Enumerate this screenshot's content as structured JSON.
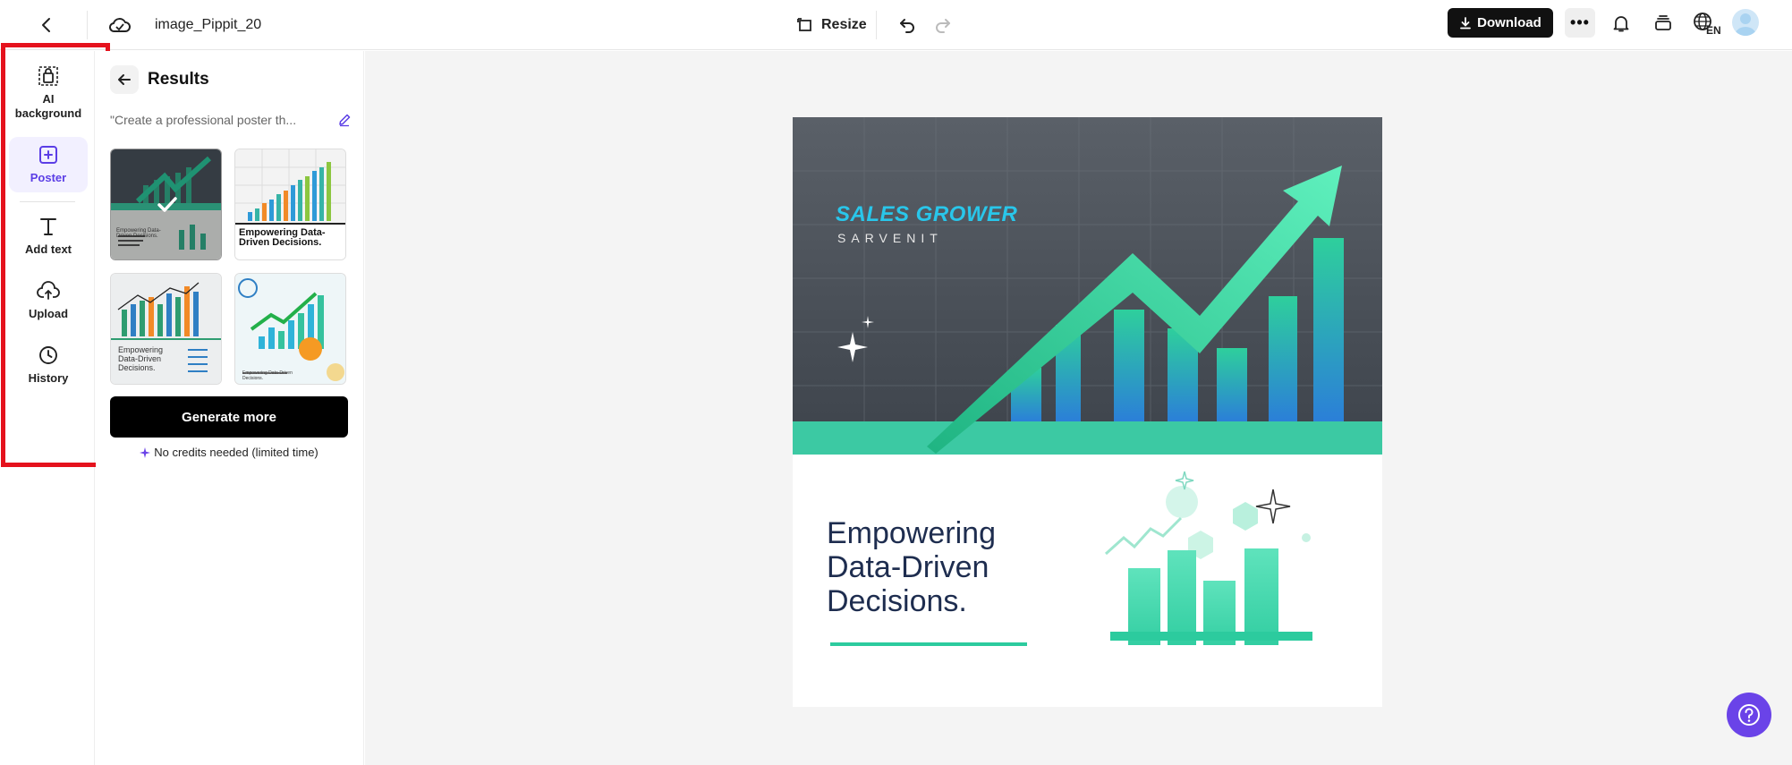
{
  "topbar": {
    "file_name": "image_Pippit_20",
    "resize_label": "Resize",
    "download_label": "Download",
    "more_label": "•••",
    "lang_code": "EN"
  },
  "rail": {
    "items": [
      {
        "label": "AI background",
        "icon": "ai-background-icon"
      },
      {
        "label": "Poster",
        "icon": "poster-icon",
        "active": true
      },
      {
        "label": "Add text",
        "icon": "text-icon"
      },
      {
        "label": "Upload",
        "icon": "upload-icon"
      },
      {
        "label": "History",
        "icon": "history-icon"
      }
    ]
  },
  "panel": {
    "title": "Results",
    "prompt": "\"Create a professional poster th...",
    "thumb_captions": [
      "Empowering Data-Driven Decisions.",
      "Empowering Data-Driven Decisions.",
      "Empowering Data-Driven Decisions.",
      "Empowering Data-Driven Decisions."
    ],
    "generate_label": "Generate more",
    "credits_label": "No credits needed (limited time)"
  },
  "poster": {
    "title": "SALES GROWER",
    "subtitle": "SARVENIT",
    "headline": "Empowering Data-Driven Decisions."
  },
  "colors": {
    "accent": "#5b3ee6",
    "download_bg": "#111111",
    "highlight_box": "#e5121d",
    "poster_teal": "#2ccb9e",
    "poster_blue": "#29c6ea",
    "help_button": "#6a43e8"
  }
}
